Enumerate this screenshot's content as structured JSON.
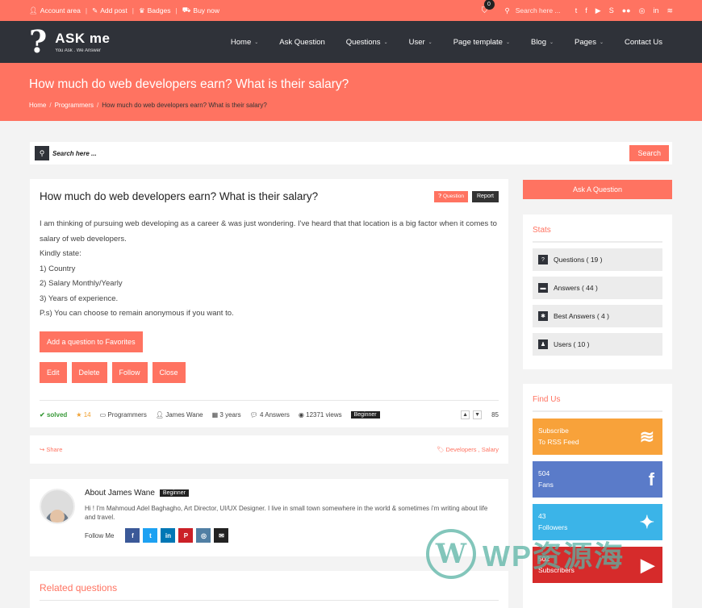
{
  "topbar": {
    "links": [
      {
        "icon": "user-icon",
        "label": "Account area"
      },
      {
        "icon": "pencil-icon",
        "label": "Add post"
      },
      {
        "icon": "trophy-icon",
        "label": "Badges"
      },
      {
        "icon": "cart-icon",
        "label": "Buy now"
      }
    ],
    "cart_count": "0",
    "search_placeholder": "Search here ...",
    "social": [
      "twitter",
      "facebook",
      "youtube",
      "skype",
      "flickr",
      "instagram",
      "linkedin",
      "rss"
    ]
  },
  "header": {
    "logo_name": "ASK me",
    "logo_tagline": "You Ask . We Answer",
    "nav": [
      {
        "label": "Home",
        "dropdown": true
      },
      {
        "label": "Ask Question",
        "dropdown": false
      },
      {
        "label": "Questions",
        "dropdown": true
      },
      {
        "label": "User",
        "dropdown": true
      },
      {
        "label": "Page template",
        "dropdown": true
      },
      {
        "label": "Blog",
        "dropdown": true
      },
      {
        "label": "Pages",
        "dropdown": true
      },
      {
        "label": "Contact Us",
        "dropdown": false
      }
    ]
  },
  "band": {
    "title": "How much do web developers earn? What is their salary?",
    "breadcrumb": [
      "Home",
      "Programmers",
      "How much do web developers earn? What is their salary?"
    ]
  },
  "search": {
    "placeholder": "Search here ...",
    "button": "Search"
  },
  "question": {
    "title": "How much do web developers earn? What is their salary?",
    "tag_question": "Question",
    "tag_report": "Report",
    "body": [
      "I am thinking of pursuing web developing as a career & was just wondering. I've heard that that location is a big factor when it comes to salary of web developers.",
      "Kindly state:",
      "1) Country",
      "2) Salary Monthly/Yearly",
      "3) Years of experience.",
      "P.s) You can choose to remain anonymous if you want to."
    ],
    "favorite_button": "Add a question to Favorites",
    "actions": [
      "Edit",
      "Delete",
      "Follow",
      "Close"
    ],
    "meta": {
      "status": "solved",
      "points": "14",
      "category": "Programmers",
      "author": "James Wane",
      "time": "3 years",
      "answers": "4 Answers",
      "views": "12371 views",
      "badge": "Beginner",
      "votes": "85"
    }
  },
  "share": {
    "label": "Share",
    "tags": "Developers , Salary"
  },
  "author": {
    "title": "About James Wane",
    "badge": "Beginner",
    "bio": "Hi ! I'm Mahmoud Adel Baghagho, Art Director, UI/UX Designer. I live in small town somewhere in the world & sometimes i'm writing about life and travel.",
    "follow_label": "Follow Me",
    "socials": [
      {
        "name": "facebook",
        "glyph": "f",
        "color": "#3b5998"
      },
      {
        "name": "twitter",
        "glyph": "t",
        "color": "#1da1f2"
      },
      {
        "name": "linkedin",
        "glyph": "in",
        "color": "#0077b5"
      },
      {
        "name": "pinterest",
        "glyph": "P",
        "color": "#cb2027"
      },
      {
        "name": "instagram",
        "glyph": "◎",
        "color": "#517fa4"
      },
      {
        "name": "email",
        "glyph": "✉",
        "color": "#222222"
      }
    ]
  },
  "related": {
    "title": "Related questions"
  },
  "sidebar": {
    "ask_button": "Ask A Question",
    "stats_title": "Stats",
    "stats": [
      {
        "icon": "question-icon",
        "label": "Questions ( 19 )"
      },
      {
        "icon": "comment-icon",
        "label": "Answers ( 44 )"
      },
      {
        "icon": "asterisk-icon",
        "label": "Best Answers ( 4 )"
      },
      {
        "icon": "user-icon",
        "label": "Users ( 10 )"
      }
    ],
    "find_title": "Find Us",
    "find": [
      {
        "name": "rss",
        "line1": "Subscribe",
        "line2": "To RSS Feed",
        "color": "#f8a23a"
      },
      {
        "name": "facebook",
        "line1": "504",
        "line2": "Fans",
        "color": "#5a7bc9"
      },
      {
        "name": "twitter",
        "line1": "43",
        "line2": "Followers",
        "color": "#3bb4e8"
      },
      {
        "name": "youtube",
        "line1": "502",
        "line2": "Subscribers",
        "color": "#d62b2b"
      }
    ]
  },
  "watermark": {
    "letter": "W",
    "text": "WP资源海"
  }
}
